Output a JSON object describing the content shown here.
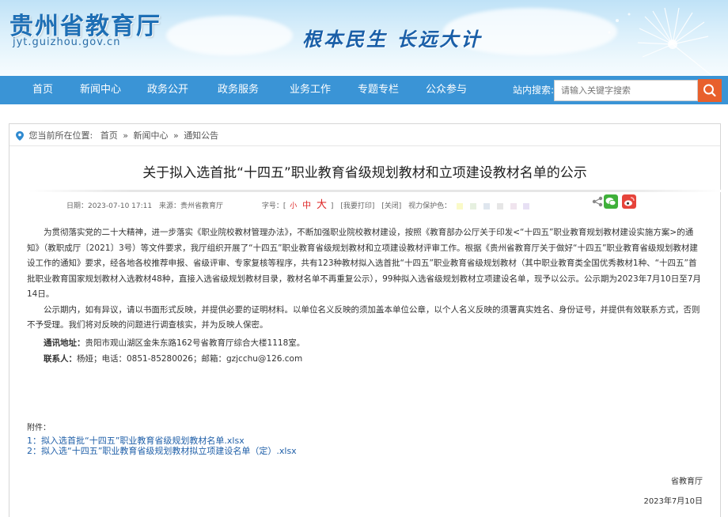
{
  "header": {
    "site_name": "贵州省教育厅",
    "site_url": "jyt.guizhou.gov.cn",
    "slogan": "根本民生 长远大计"
  },
  "nav": {
    "items": [
      "首页",
      "新闻中心",
      "政务公开",
      "政务服务",
      "业务工作",
      "专题专栏",
      "公众参与"
    ],
    "search_label": "站内搜索:",
    "search_placeholder": "请输入关键字搜索"
  },
  "breadcrumb": {
    "prefix": "您当前所在位置:",
    "items": [
      "首页",
      "新闻中心",
      "通知公告"
    ],
    "separator": "»"
  },
  "article": {
    "title": "关于拟入选首批“十四五”职业教育省级规划教材和立项建设教材名单的公示",
    "date": "日期：2023-07-10 17:11",
    "source": "来源：贵州省教育厅",
    "font_label": "字号：[",
    "font_small": "小",
    "font_mid": "中",
    "font_big": "大",
    "font_close": "]",
    "print": "[我要打印]",
    "close": "[关闭]",
    "eye_protect": "视力保护色：",
    "swatch_colors": [
      "#fafac8",
      "#e6f0e0",
      "#dfe6ee",
      "#e6e6e6",
      "#f0e4ee",
      "#e7e0f4"
    ],
    "paragraphs": [
      "为贯彻落实党的二十大精神，进一步落实《职业院校教材管理办法》，不断加强职业院校教材建设，按照《教育部办公厅关于印发<“十四五”职业教育规划教材建设实施方案>的通知》（教职成厅〔2021〕3号）等文件要求，我厅组织开展了“十四五”职业教育省级规划教材和立项建设教材评审工作。根据《贵州省教育厅关于做好“十四五”职业教育省级规划教材建设工作的通知》要求，经各地各校推荐申报、省级评审、专家复核等程序，共有123种教材拟入选首批“十四五”职业教育省级规划教材（其中职业教育类全国优秀教材1种、“十四五”首批职业教育国家规划教材入选教材48种，直接入选省级规划教材目录，教材名单不再重复公示），99种拟入选省级规划教材立项建设名单，现予以公示。公示期为2023年7月10日至7月14日。",
      "公示期内，如有异议，请以书面形式反映，并提供必要的证明材料。以单位名义反映的须加盖本单位公章，以个人名义反映的须署真实姓名、身份证号，并提供有效联系方式，否则不予受理。我们将对反映的问题进行调查核实，并为反映人保密。"
    ],
    "address_label": "通讯地址：",
    "address_value": "贵阳市观山湖区金朱东路162号省教育厅综合大楼1118室。",
    "contact_label": "联系人：",
    "contact_value": "杨娅；电话：0851-85280026；邮箱：gzjcchu@126.com",
    "attachments_label": "附件：",
    "attachments": [
      "1：拟入选首批“十四五”职业教育省级规划教材名单.xlsx",
      "2：拟入选“十四五”职业教育省级规划教材拟立项建设名单（定）.xlsx"
    ],
    "signature_org": "省教育厅",
    "signature_date": "2023年7月10日"
  },
  "colors": {
    "nav_bg": "#3a94d6",
    "search_btn": "#e8602c",
    "link": "#1f5fa8",
    "accent_red": "#d22"
  },
  "icons": {
    "share": "share-icon",
    "wechat": "wechat-icon",
    "weibo": "weibo-icon",
    "search": "search-icon",
    "location": "location-pin-icon"
  }
}
